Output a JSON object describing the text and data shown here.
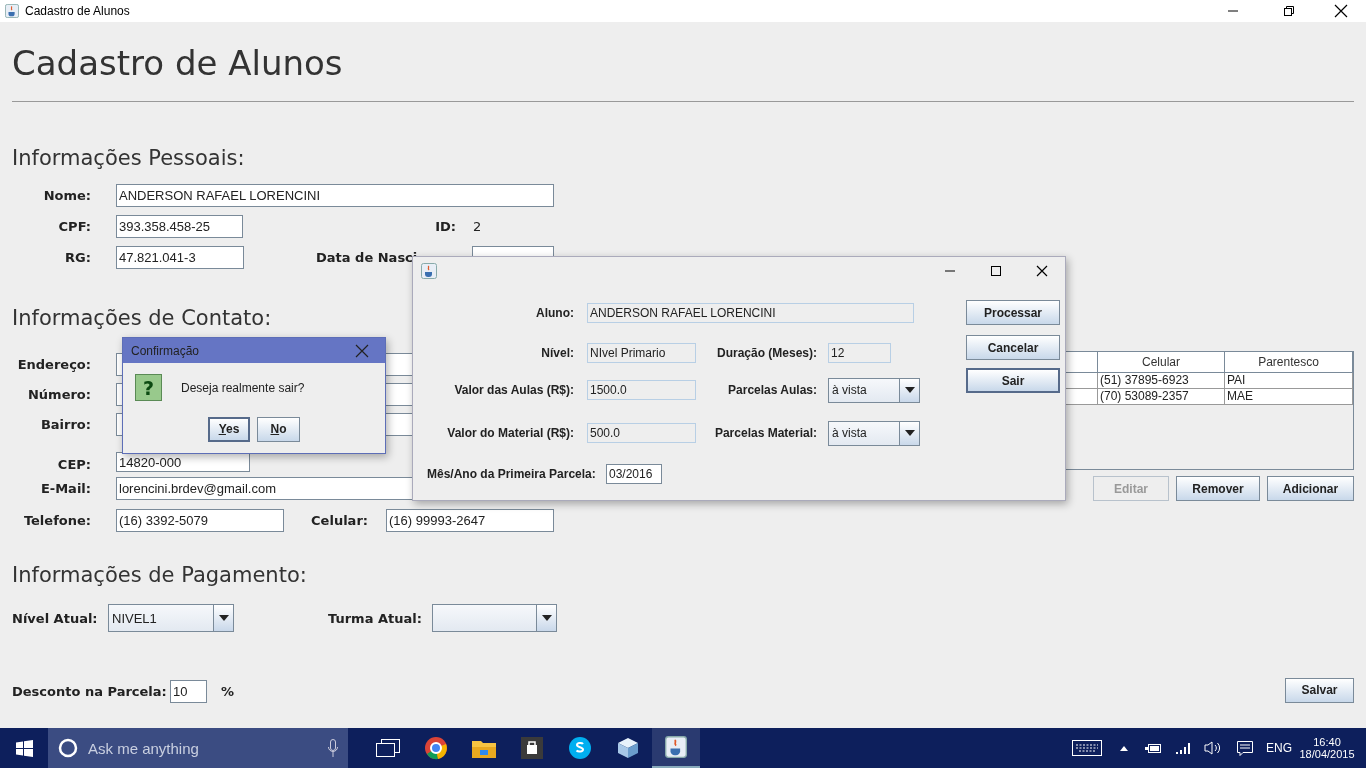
{
  "window": {
    "title": "Cadastro de Alunos"
  },
  "heading": "Cadastro de Alunos",
  "personal": {
    "title": "Informações Pessoais:",
    "nome": {
      "label": "Nome:",
      "value": "ANDERSON RAFAEL LORENCINI"
    },
    "cpf": {
      "label": "CPF:",
      "value": "393.358.458-25"
    },
    "id": {
      "label": "ID:",
      "value": "2"
    },
    "rg": {
      "label": "RG:",
      "value": "47.821.041-3"
    },
    "birth": {
      "label": "Data de Nasci"
    }
  },
  "contact": {
    "title": "Informações de Contato:",
    "fields": [
      {
        "label": "Endereço:"
      },
      {
        "label": "Número:"
      },
      {
        "label": "Bairro:"
      },
      {
        "label": "CEP:",
        "value": "14820-000"
      },
      {
        "label": "E-Mail:",
        "value": "lorencini.brdev@gmail.com"
      }
    ],
    "telefone": {
      "label": "Telefone:",
      "value": "(16) 3392-5079"
    },
    "celular": {
      "label": "Celular:",
      "value": "(16) 99993-2647"
    },
    "table": {
      "columns": [
        "Celular",
        "Parentesco"
      ],
      "rows": [
        [
          "(51) 37895-6923",
          "PAI"
        ],
        [
          "(70) 53089-2357",
          "MAE"
        ]
      ]
    },
    "buttons": [
      {
        "label": "Editar",
        "disabled": true
      },
      {
        "label": "Remover",
        "disabled": false
      },
      {
        "label": "Adicionar",
        "disabled": false
      }
    ]
  },
  "payment": {
    "title": "Informações de Pagamento:",
    "nivel": {
      "label": "Nível Atual:",
      "value": "NIVEL1"
    },
    "turma": {
      "label": "Turma Atual:"
    },
    "desconto": {
      "label": "Desconto na Parcela:",
      "value": "10",
      "unit": "%"
    },
    "save": "Salvar"
  },
  "process_dialog": {
    "aluno": {
      "label": "Aluno:",
      "value": "ANDERSON RAFAEL LORENCINI"
    },
    "rows": [
      {
        "left": {
          "label": "Nível:",
          "value": "NIvel Primario"
        },
        "right": {
          "kind": "text",
          "label": "Duração (Meses):",
          "value": "12"
        }
      },
      {
        "left": {
          "label": "Valor das Aulas (R$):",
          "value": "1500.0"
        },
        "right": {
          "kind": "combo",
          "label": "Parcelas Aulas:",
          "value": "à vista"
        }
      },
      {
        "left": {
          "label": "Valor do Material (R$):",
          "value": "500.0"
        },
        "right": {
          "kind": "combo",
          "label": "Parcelas Material:",
          "value": "à vista"
        }
      }
    ],
    "first": {
      "label": "Mês/Ano da Primeira Parcela:",
      "value": "03/2016"
    },
    "buttons": [
      {
        "label": "Processar",
        "focused": false
      },
      {
        "label": "Cancelar",
        "focused": false
      },
      {
        "label": "Sair",
        "focused": true
      }
    ]
  },
  "confirm_dialog": {
    "title": "Confirmação",
    "icon": "?",
    "message": "Deseja realmente sair?",
    "buttons": [
      {
        "label": "Yes",
        "focused": true
      },
      {
        "label": "No",
        "focused": false
      }
    ]
  },
  "taskbar": {
    "search_placeholder": "Ask me anything",
    "language": "ENG",
    "time": "16:40",
    "date": "18/04/2015"
  }
}
